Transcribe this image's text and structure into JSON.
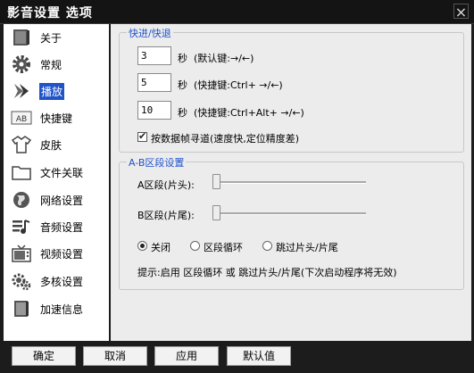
{
  "window": {
    "title": "影音设置 选项",
    "close_glyph": "×"
  },
  "sidebar": {
    "items": [
      {
        "label": "关于",
        "icon": "info-icon"
      },
      {
        "label": "常规",
        "icon": "gear-icon"
      },
      {
        "label": "播放",
        "icon": "play-icon",
        "active": true
      },
      {
        "label": "快捷键",
        "icon": "keyboard-icon",
        "icon_text": "AB"
      },
      {
        "label": "皮肤",
        "icon": "shirt-icon"
      },
      {
        "label": "文件关联",
        "icon": "folder-icon"
      },
      {
        "label": "网络设置",
        "icon": "globe-icon"
      },
      {
        "label": "音频设置",
        "icon": "music-icon"
      },
      {
        "label": "视频设置",
        "icon": "tv-icon"
      },
      {
        "label": "多核设置",
        "icon": "multicore-icon"
      },
      {
        "label": "加速信息",
        "icon": "book-icon"
      }
    ]
  },
  "seek": {
    "title": "快进/快退",
    "rows": [
      {
        "value": "3",
        "unit": "秒",
        "hint": "(默认键:→/←)"
      },
      {
        "value": "5",
        "unit": "秒",
        "hint": "(快捷键:Ctrl+ →/←)"
      },
      {
        "value": "10",
        "unit": "秒",
        "hint": "(快捷键:Ctrl+Alt+ →/←)"
      }
    ],
    "keyframe_checkbox": {
      "label": "按数据帧寻道(速度快,定位精度差)",
      "checked": true
    }
  },
  "ab": {
    "title": "A-B区段设置",
    "a_label": "A区段(片头):",
    "b_label": "B区段(片尾):",
    "a_value": 0,
    "b_value": 0,
    "radios": [
      {
        "label": "关闭",
        "selected": true
      },
      {
        "label": "区段循环",
        "selected": false
      },
      {
        "label": "跳过片头/片尾",
        "selected": false
      }
    ],
    "tip": "提示:启用 区段循环 或 跳过片头/片尾(下次启动程序将无效)"
  },
  "buttons": {
    "ok": "确定",
    "cancel": "取消",
    "apply": "应用",
    "default": "默认值"
  },
  "colors": {
    "accent": "#1f53c9",
    "frame": "#1c1c1c",
    "panel": "#ececec"
  }
}
